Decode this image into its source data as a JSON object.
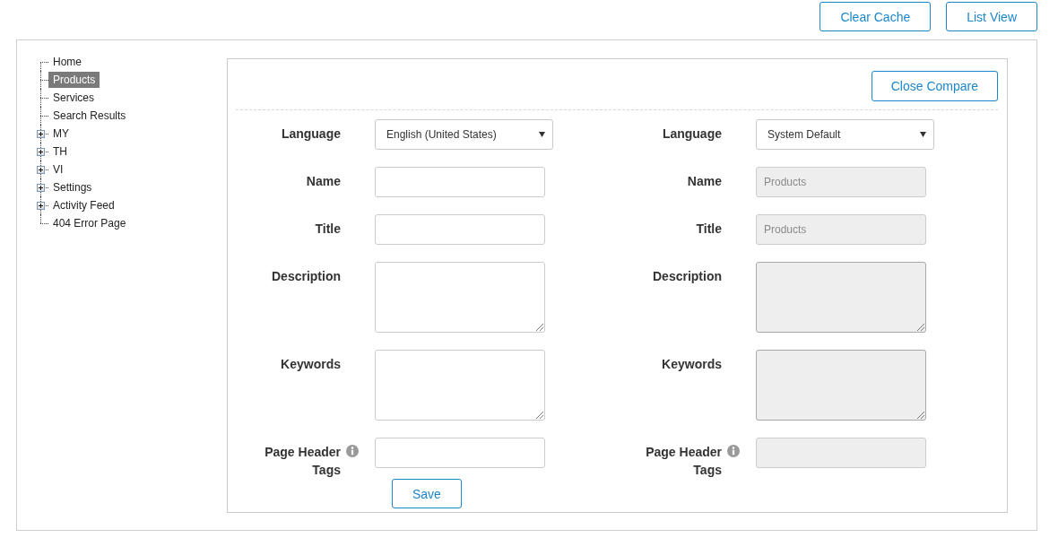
{
  "toolbar": {
    "buttons": [
      {
        "label": "Clear Cache"
      },
      {
        "label": "List View"
      }
    ]
  },
  "tree": {
    "items": [
      {
        "label": "Home",
        "selected": false
      },
      {
        "label": "Products",
        "selected": true
      },
      {
        "label": "Services",
        "selected": false
      },
      {
        "label": "Search Results",
        "selected": false
      },
      {
        "label": "MY",
        "selected": false,
        "expanded": false
      },
      {
        "label": "TH",
        "selected": false,
        "expanded": false
      },
      {
        "label": "VI",
        "selected": false,
        "expanded": false
      },
      {
        "label": "Settings",
        "selected": false,
        "expanded": false
      },
      {
        "label": "Activity Feed",
        "selected": false,
        "expanded": false
      },
      {
        "label": "404 Error Page",
        "selected": false
      }
    ]
  },
  "compare": {
    "close_button": {
      "label": "Close Compare"
    },
    "columns": [
      {
        "fields": [
          {
            "kind": "select",
            "label": "Language",
            "value": "English (United States)",
            "disabled": false
          },
          {
            "kind": "text",
            "label": "Name",
            "disabled": false
          },
          {
            "kind": "text",
            "label": "Title",
            "disabled": false
          },
          {
            "kind": "textarea",
            "label": "Description",
            "disabled": false
          },
          {
            "kind": "textarea",
            "label": "Keywords",
            "disabled": false
          },
          {
            "kind": "text",
            "label": "Page Header Tags",
            "disabled": false,
            "info_icon": true
          }
        ],
        "save_button": {
          "label": "Save"
        }
      },
      {
        "fields": [
          {
            "kind": "select",
            "label": "Language",
            "value": "System Default",
            "disabled": false
          },
          {
            "kind": "text",
            "label": "Name",
            "value": "Products",
            "disabled": true
          },
          {
            "kind": "text",
            "label": "Title",
            "value": "Products",
            "disabled": true
          },
          {
            "kind": "textarea",
            "label": "Description",
            "disabled": true
          },
          {
            "kind": "textarea",
            "label": "Keywords",
            "disabled": true
          },
          {
            "kind": "text",
            "label": "Page Header Tags",
            "disabled": true,
            "info_icon": true
          }
        ]
      }
    ]
  }
}
